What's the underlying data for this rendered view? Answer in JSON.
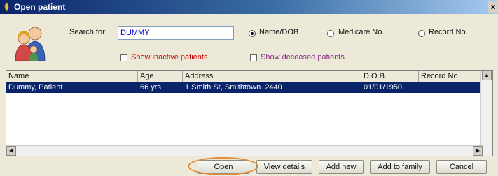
{
  "window": {
    "title": "Open patient",
    "close_label": "x"
  },
  "search": {
    "label": "Search for:",
    "value": "DUMMY"
  },
  "search_by": {
    "options": [
      {
        "label": "Name/DOB",
        "selected": true
      },
      {
        "label": "Medicare No.",
        "selected": false
      },
      {
        "label": "Record No.",
        "selected": false
      }
    ]
  },
  "filters": {
    "show_inactive": {
      "label": "Show inactive patients",
      "checked": false
    },
    "show_deceased": {
      "label": "Show deceased patients",
      "checked": false
    }
  },
  "table": {
    "columns": [
      "Name",
      "Age",
      "Address",
      "D.O.B.",
      "Record No."
    ],
    "rows": [
      {
        "name": "Dummy, Patient",
        "age": "66 yrs",
        "address": "1 Smith St, Smithtown. 2440",
        "dob": "01/01/1950",
        "record_no": ""
      }
    ]
  },
  "buttons": {
    "open": "Open",
    "view_details": "View details",
    "add_new": "Add new",
    "add_to_family": "Add to family",
    "cancel": "Cancel"
  },
  "colors": {
    "titlebar": "#0a246a",
    "selection": "#0a246a",
    "highlight_ring": "#e08a3c"
  },
  "icons": [
    "patient-avatar-icon",
    "app-icon",
    "close-icon",
    "scroll-left-icon",
    "scroll-right-icon",
    "scroll-up-icon"
  ]
}
